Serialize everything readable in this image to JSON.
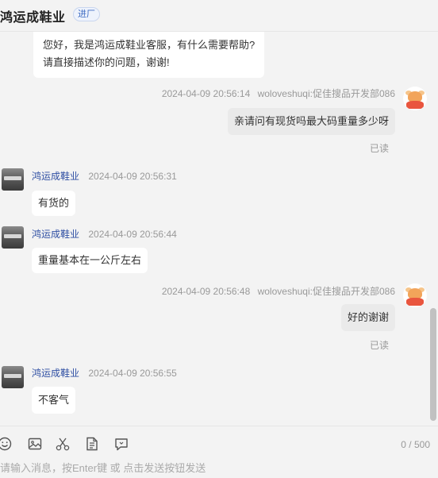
{
  "header": {
    "shop_name": "鸿运成鞋业",
    "shop_tag": "进厂"
  },
  "messages": [
    {
      "from": "shop",
      "lines": [
        "您好，我是鸿运成鞋业客服，有什么需要帮助?",
        "请直接描述你的问题，谢谢!"
      ]
    },
    {
      "from": "user",
      "timestamp": "2024-04-09 20:56:14",
      "sender": "woloveshuqi:促佳搜品开发部086",
      "text": "亲请问有现货吗最大码重量多少呀",
      "status": "已读"
    },
    {
      "from": "shop",
      "sender": "鸿运成鞋业",
      "timestamp": "2024-04-09 20:56:31",
      "text": "有货的"
    },
    {
      "from": "shop",
      "sender": "鸿运成鞋业",
      "timestamp": "2024-04-09 20:56:44",
      "text": "重量基本在一公斤左右"
    },
    {
      "from": "user",
      "timestamp": "2024-04-09 20:56:48",
      "sender": "woloveshuqi:促佳搜品开发部086",
      "text": "好的谢谢",
      "status": "已读"
    },
    {
      "from": "shop",
      "sender": "鸿运成鞋业",
      "timestamp": "2024-04-09 20:56:55",
      "text": "不客气"
    }
  ],
  "toolbar": {
    "icons": [
      "emoji-icon",
      "image-icon",
      "scissors-icon",
      "document-icon",
      "quick-reply-icon"
    ],
    "counter": "0 / 500"
  },
  "input": {
    "placeholder": "请输入消息，按Enter键 或 点击发送按钮发送"
  }
}
